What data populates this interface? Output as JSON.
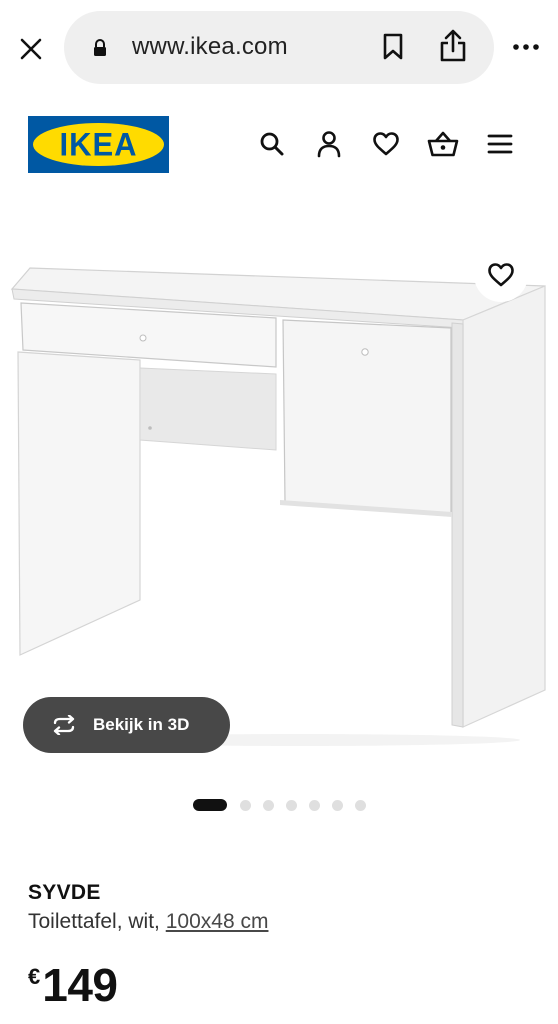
{
  "browser": {
    "url": "www.ikea.com",
    "icons": {
      "close": "close-icon",
      "lock": "lock-icon",
      "bookmark": "bookmark-icon",
      "share": "share-icon",
      "more": "more-icon"
    }
  },
  "header": {
    "logo_text": "IKEA",
    "icons": [
      "search-icon",
      "user-icon",
      "heart-icon",
      "basket-icon",
      "menu-icon"
    ]
  },
  "gallery": {
    "view_3d_label": "Bekijk in 3D",
    "dots_count": 7,
    "active_dot": 0
  },
  "product": {
    "name": "SYVDE",
    "description": "Toilettafel, wit,",
    "size": "100x48 cm",
    "currency": "€",
    "price": "149"
  },
  "colors": {
    "ikea_blue": "#0058a3",
    "ikea_yellow": "#ffdb00",
    "button_dark": "#484848"
  }
}
